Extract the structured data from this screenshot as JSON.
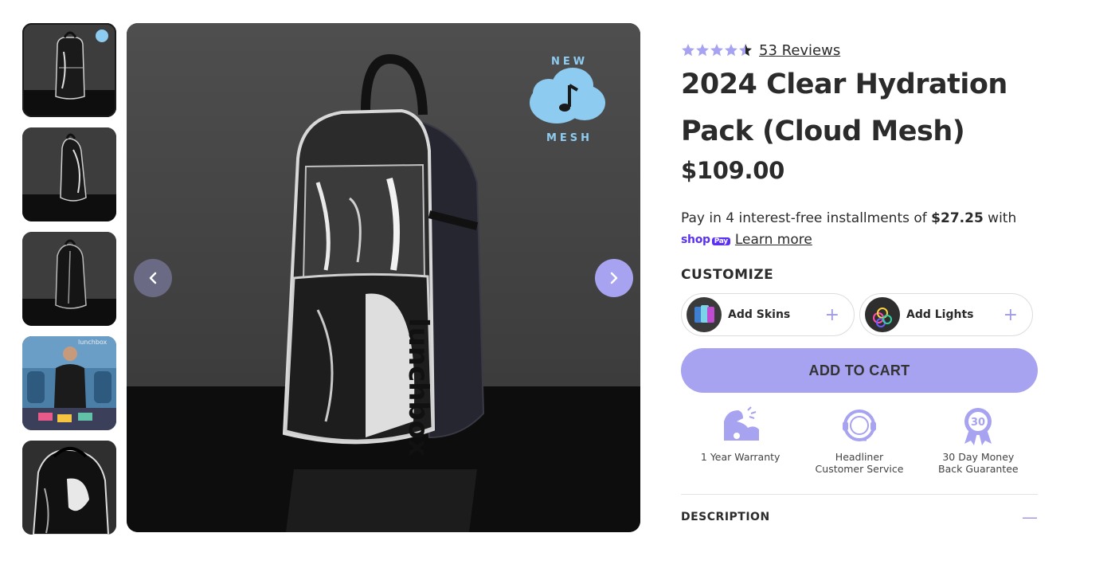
{
  "product": {
    "title_line1": "2024 Clear Hydration",
    "title_line2": "Pack (Cloud Mesh)",
    "price": "$109.00",
    "rating": 4.5,
    "reviews_label": "53 Reviews"
  },
  "payment": {
    "prefix": "Pay in 4 interest-free installments of ",
    "amount": "$27.25",
    "suffix": " with",
    "shop_logo": "shop",
    "pay_badge": "Pay",
    "learn_more": "Learn more"
  },
  "customize": {
    "heading": "CUSTOMIZE",
    "addons": [
      {
        "label": "Add Skins",
        "icon": "plus-icon"
      },
      {
        "label": "Add Lights",
        "icon": "plus-icon"
      }
    ]
  },
  "cart": {
    "label": "ADD TO CART"
  },
  "features": [
    {
      "line1": "1 Year Warranty",
      "line2": "",
      "icon": "flexed-arm-icon"
    },
    {
      "line1": "Headliner",
      "line2": "Customer Service",
      "icon": "headset-icon"
    },
    {
      "line1": "30 Day Money",
      "line2": "Back Guarantee",
      "icon": "badge-30-icon"
    }
  ],
  "badge": {
    "top": "NEW",
    "bottom": "MESH"
  },
  "thumb_logo": "lunchbox",
  "description": {
    "label": "DESCRIPTION",
    "toggle": "—"
  },
  "bag_brand": "lunchbox",
  "colors": {
    "accent": "#a7a3f0",
    "shop_purple": "#5a31f4",
    "badge_blue": "#8ecbf0"
  }
}
